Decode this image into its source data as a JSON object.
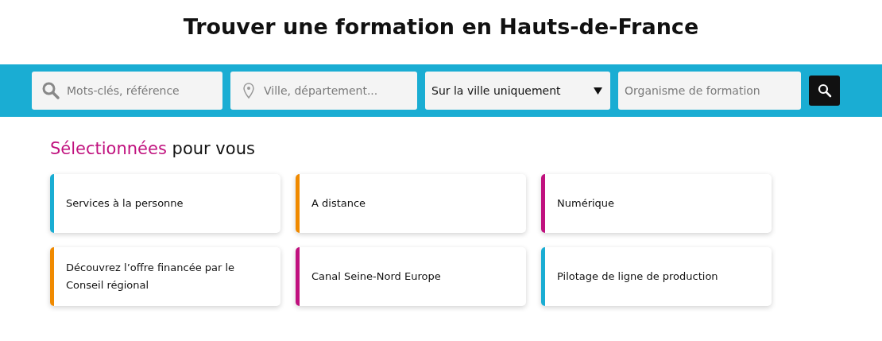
{
  "page_title": "Trouver une formation en Hauts-de-France",
  "search_bar": {
    "keywords": {
      "placeholder": "Mots-clés, référence"
    },
    "location": {
      "placeholder": "Ville, département..."
    },
    "scope": {
      "value": "Sur la ville uniquement"
    },
    "organisation": {
      "placeholder": "Organisme de formation"
    }
  },
  "section": {
    "heading_highlight": "Sélectionnées",
    "heading_rest": "pour vous",
    "cards": [
      {
        "label": "Services à la personne",
        "color": "#1aadd3"
      },
      {
        "label": "A distance",
        "color": "#f08a00"
      },
      {
        "label": "Numérique",
        "color": "#c0117e"
      },
      {
        "label": "Découvrez l’offre financée par le Conseil régional",
        "color": "#f08a00"
      },
      {
        "label": "Canal Seine-Nord Europe",
        "color": "#c0117e"
      },
      {
        "label": "Pilotage de ligne de production",
        "color": "#1aadd3"
      }
    ]
  }
}
